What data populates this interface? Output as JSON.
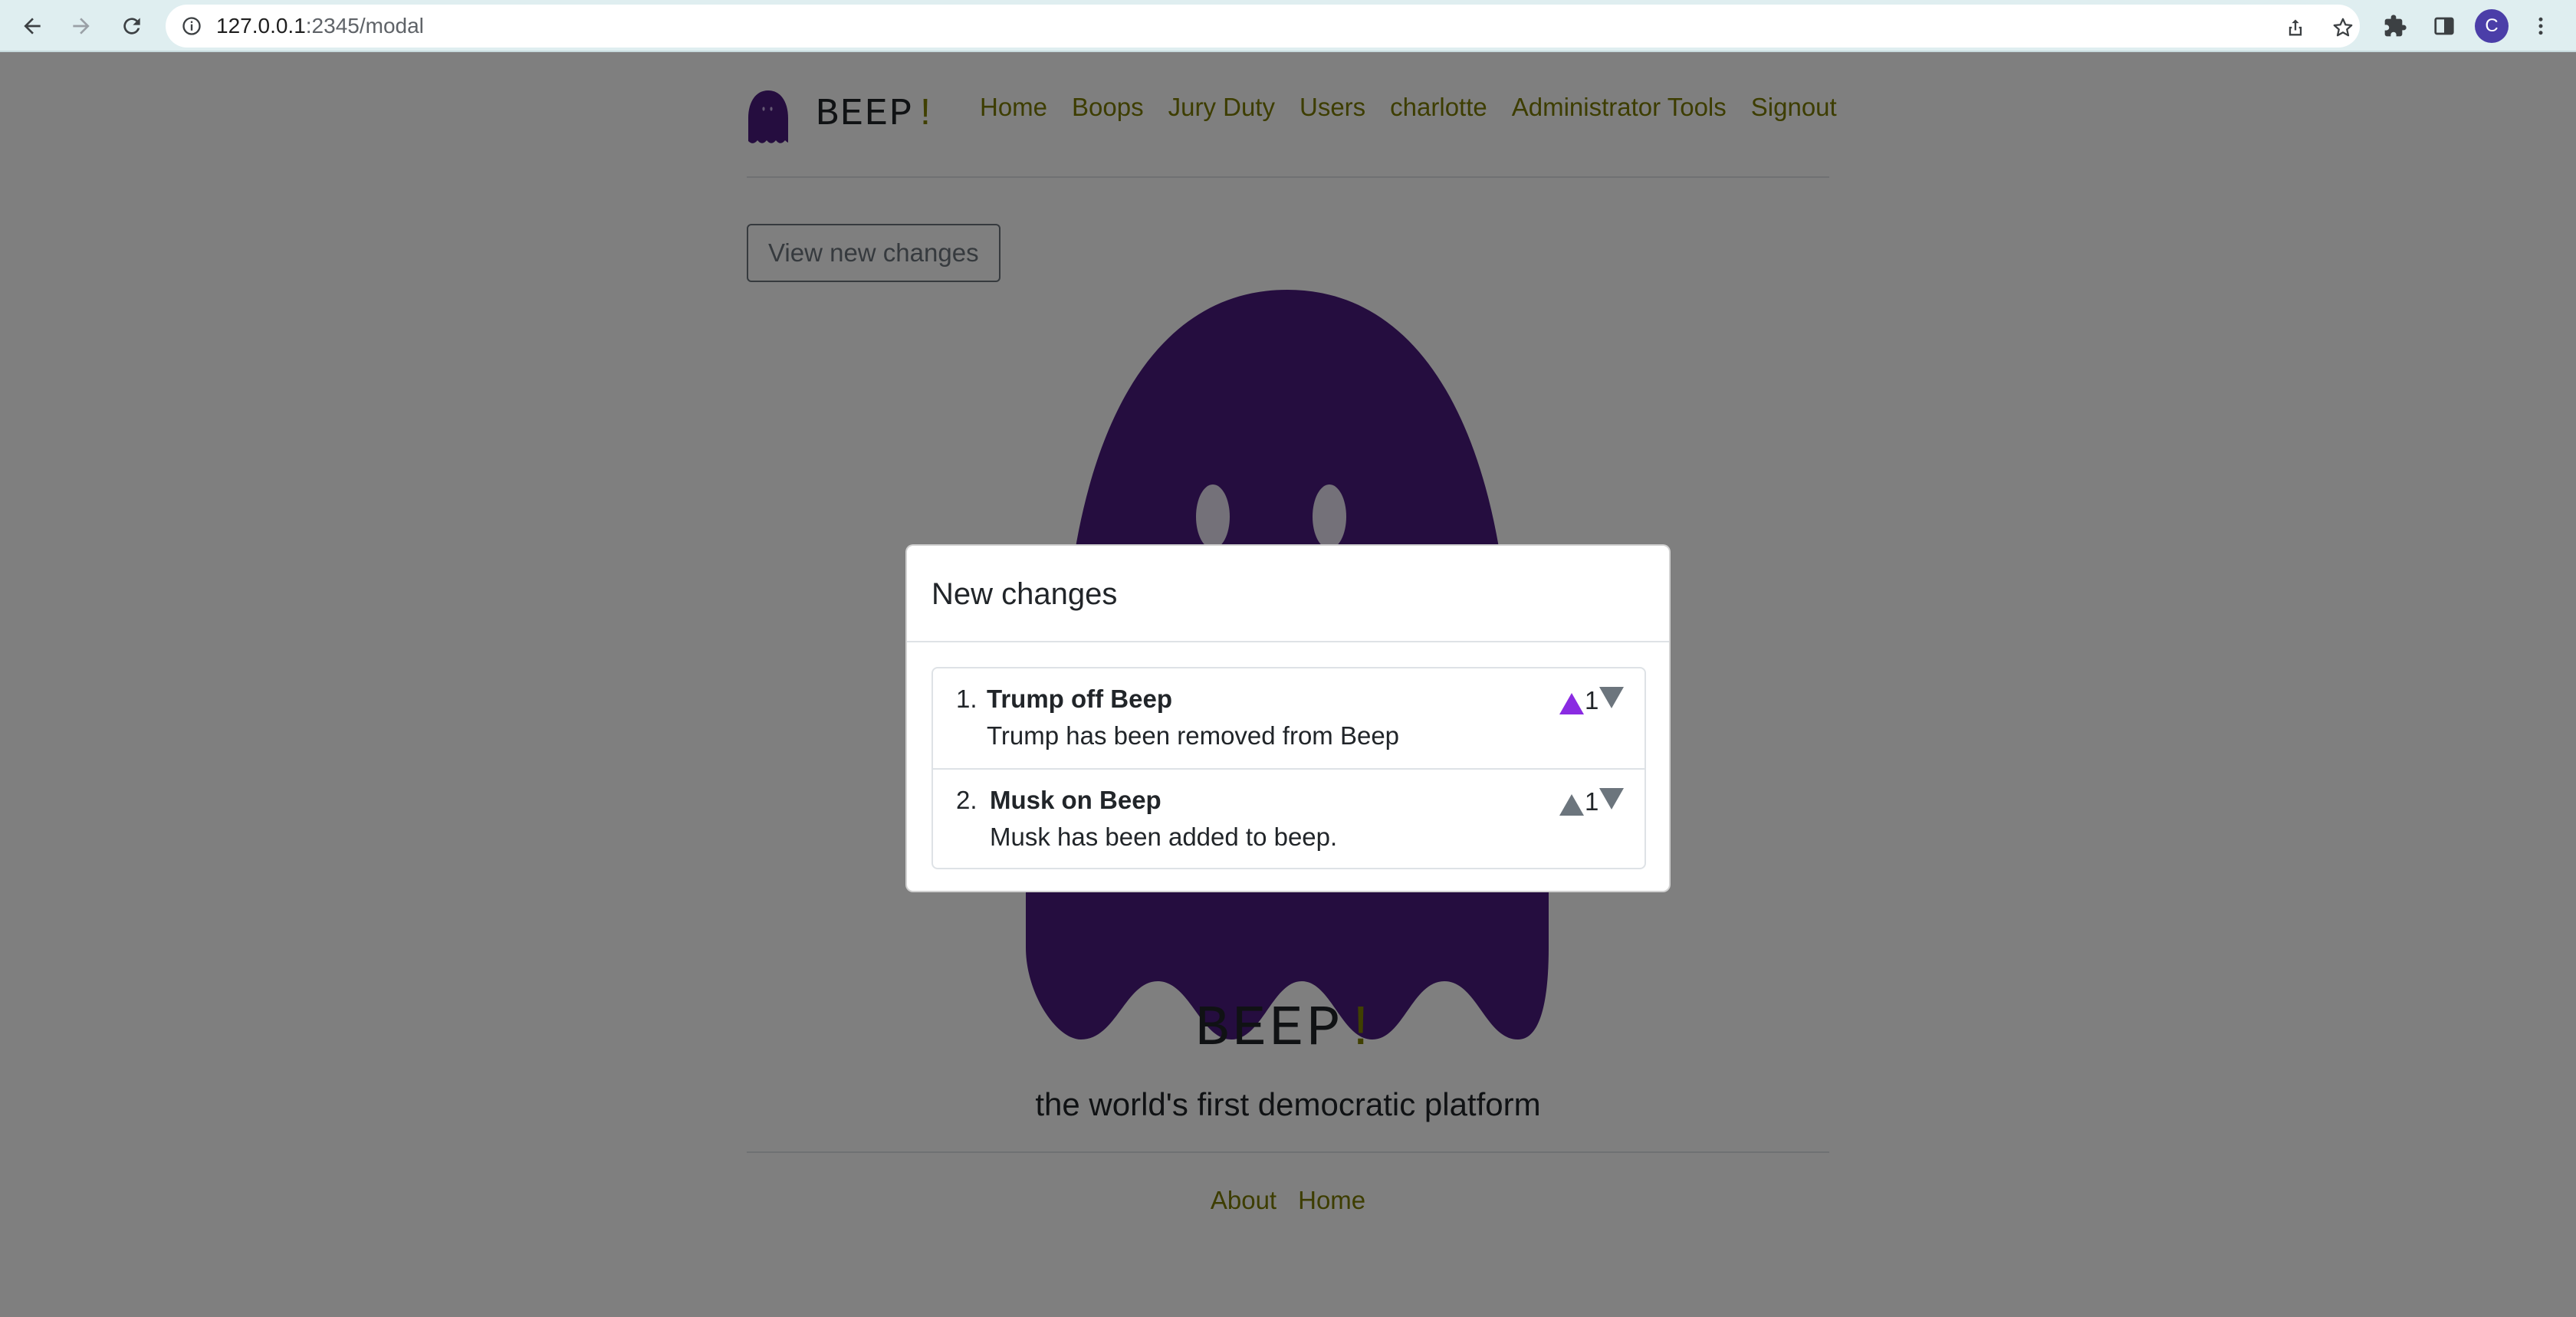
{
  "browser": {
    "url_host": "127.0.0.1",
    "url_path": ":2345/modal",
    "profile_initial": "C",
    "icons": [
      "back-icon",
      "forward-icon",
      "reload-icon",
      "info-icon",
      "share-icon",
      "star-icon",
      "extensions-icon",
      "sidepanel-icon",
      "kebab-menu-icon"
    ]
  },
  "header": {
    "brand": "BEEP",
    "brand_bang": "!",
    "nav": [
      "Home",
      "Boops",
      "Jury Duty",
      "Users",
      "charlotte",
      "Administrator Tools",
      "Signout"
    ]
  },
  "main": {
    "view_changes_label": "View new changes",
    "hero_title": "BEEP",
    "hero_bang": "!",
    "tagline": "the world's first democratic platform"
  },
  "footer": {
    "links": [
      "About",
      "Home"
    ]
  },
  "modal": {
    "title": "New changes",
    "changes": [
      {
        "num": "1.",
        "title": "Trump off Beep",
        "description": "Trump has been removed from Beep",
        "votes": "1",
        "upvoted": true
      },
      {
        "num": "2.",
        "title": "Musk on Beep",
        "description": "Musk has been added to beep.",
        "votes": "1",
        "upvoted": false
      }
    ]
  },
  "colors": {
    "ghost_purple": "#4b1a7e",
    "nav_link": "#808000",
    "upvote_active": "#8a2be2",
    "vote_inactive": "#6c757d"
  }
}
